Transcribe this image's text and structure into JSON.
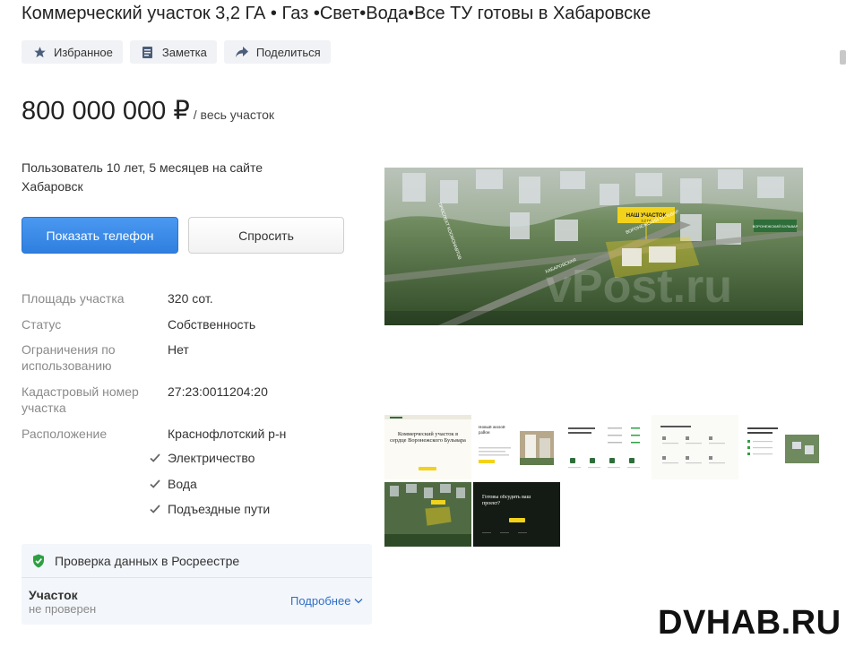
{
  "listing": {
    "title": "Коммерческий участок 3,2 ГА • Газ •Свет•Вода•Все ТУ готовы в Хабаровске",
    "price_amount": "800 000 000 ₽",
    "price_unit": "/ весь участок"
  },
  "actions": [
    {
      "label": "Избранное",
      "icon": "star-icon"
    },
    {
      "label": "Заметка",
      "icon": "note-icon"
    },
    {
      "label": "Поделиться",
      "icon": "share-icon"
    }
  ],
  "seller": {
    "line1": "Пользователь 10 лет, 5 месяцев на сайте",
    "line2": "Хабаровск"
  },
  "buttons": {
    "phone": "Показать телефон",
    "ask": "Спросить"
  },
  "properties": [
    {
      "label": "Площадь участка",
      "value": "320 сот."
    },
    {
      "label": "Статус",
      "value": "Собственность"
    },
    {
      "label": "Ограничения по использованию",
      "value": "Нет"
    },
    {
      "label": "Кадастровый номер участка",
      "value": "27:23:0011204:20"
    },
    {
      "label": "Расположение",
      "value": "Краснофлотский р-н"
    }
  ],
  "features": [
    "Электричество",
    "Вода",
    "Подъездные пути"
  ],
  "rosreestr": {
    "title": "Проверка данных в Росреестре",
    "object": "Участок",
    "status": "не проверен",
    "more": "Подробнее"
  },
  "photo": {
    "badge_title": "НАШ УЧАСТОК",
    "badge_sub": "3,2 ГА",
    "street_labels": [
      "ПРОСПЕКТ КОСМОНАВТОВ",
      "ВОРОНЕЖСКИЙ БУЛЬВАР",
      "ХАБАРОВСКАЯ"
    ],
    "sign_text": "ВОРОНЕЖСКИЙ БУЛЬВАР",
    "watermark": "vPost.ru"
  },
  "thumbs": [
    {
      "kind": "text",
      "text": "Коммерческий участок в сердце Воронежского Бульвара"
    },
    {
      "kind": "split",
      "text": "Новый жилой район"
    },
    {
      "kind": "cards",
      "text": ""
    },
    {
      "kind": "cards",
      "text": ""
    },
    {
      "kind": "map",
      "text": ""
    },
    {
      "kind": "aerial",
      "text": ""
    },
    {
      "kind": "dark",
      "text": "Готовы обсудить ваш проект?"
    }
  ],
  "site_watermark": "DVHAB.RU",
  "colors": {
    "primary": "#2f7fe0",
    "link": "#2f6fc8",
    "accent_yellow": "#f2d21a",
    "check_green": "#2ea043"
  }
}
